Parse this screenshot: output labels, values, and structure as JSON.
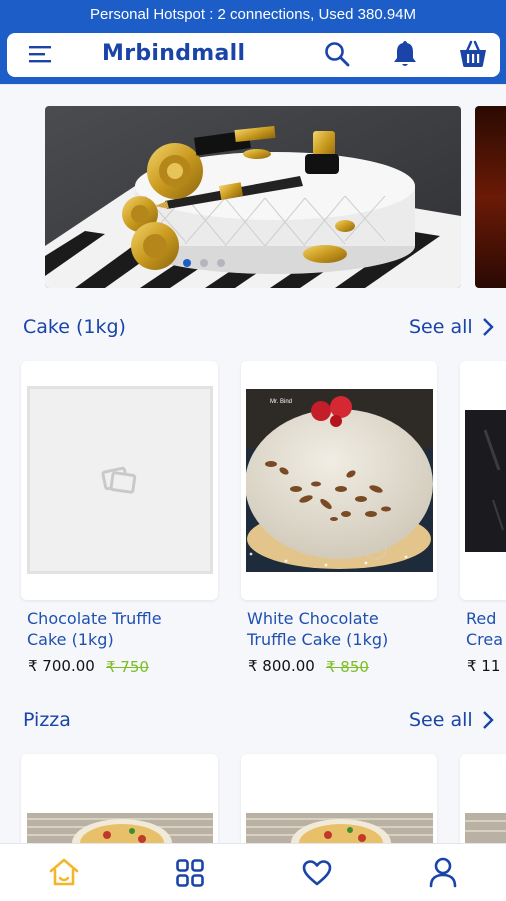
{
  "status_bar": {
    "text": "Personal Hotspot : 2 connections, Used 380.94M"
  },
  "header": {
    "title": "Mrbindmall",
    "menu_icon": "hamburger-menu-icon",
    "search_icon": "search-icon",
    "notification_icon": "bell-icon",
    "cart_icon": "basket-icon"
  },
  "banner": {
    "slides_total": 3,
    "active_index": 0
  },
  "sections": [
    {
      "title": "Cake (1kg)",
      "see_all": "See all",
      "products": [
        {
          "name_line1": "Chocolate Truffle",
          "name_line2": "Cake (1kg)",
          "price": "₹ 700.00",
          "mrp": "₹ 750"
        },
        {
          "name_line1": "White Chocolate",
          "name_line2": "Truffle Cake (1kg)",
          "price": "₹ 800.00",
          "mrp": "₹ 850"
        },
        {
          "name_line1": "Red",
          "name_line2": "Crea",
          "price": "₹ 11"
        }
      ]
    },
    {
      "title": "Pizza",
      "see_all": "See all"
    }
  ],
  "image_text": {
    "watermark": "Mr. Bind"
  },
  "bottom_nav": {
    "items": [
      {
        "icon": "home-icon",
        "active": true
      },
      {
        "icon": "grid-icon",
        "active": false
      },
      {
        "icon": "heart-icon",
        "active": false
      },
      {
        "icon": "user-icon",
        "active": false
      }
    ]
  },
  "colors": {
    "primary": "#1c5dc7",
    "brand_text": "#1a44a8",
    "active_nav": "#f2b62b",
    "mrp": "#7bbf24"
  }
}
